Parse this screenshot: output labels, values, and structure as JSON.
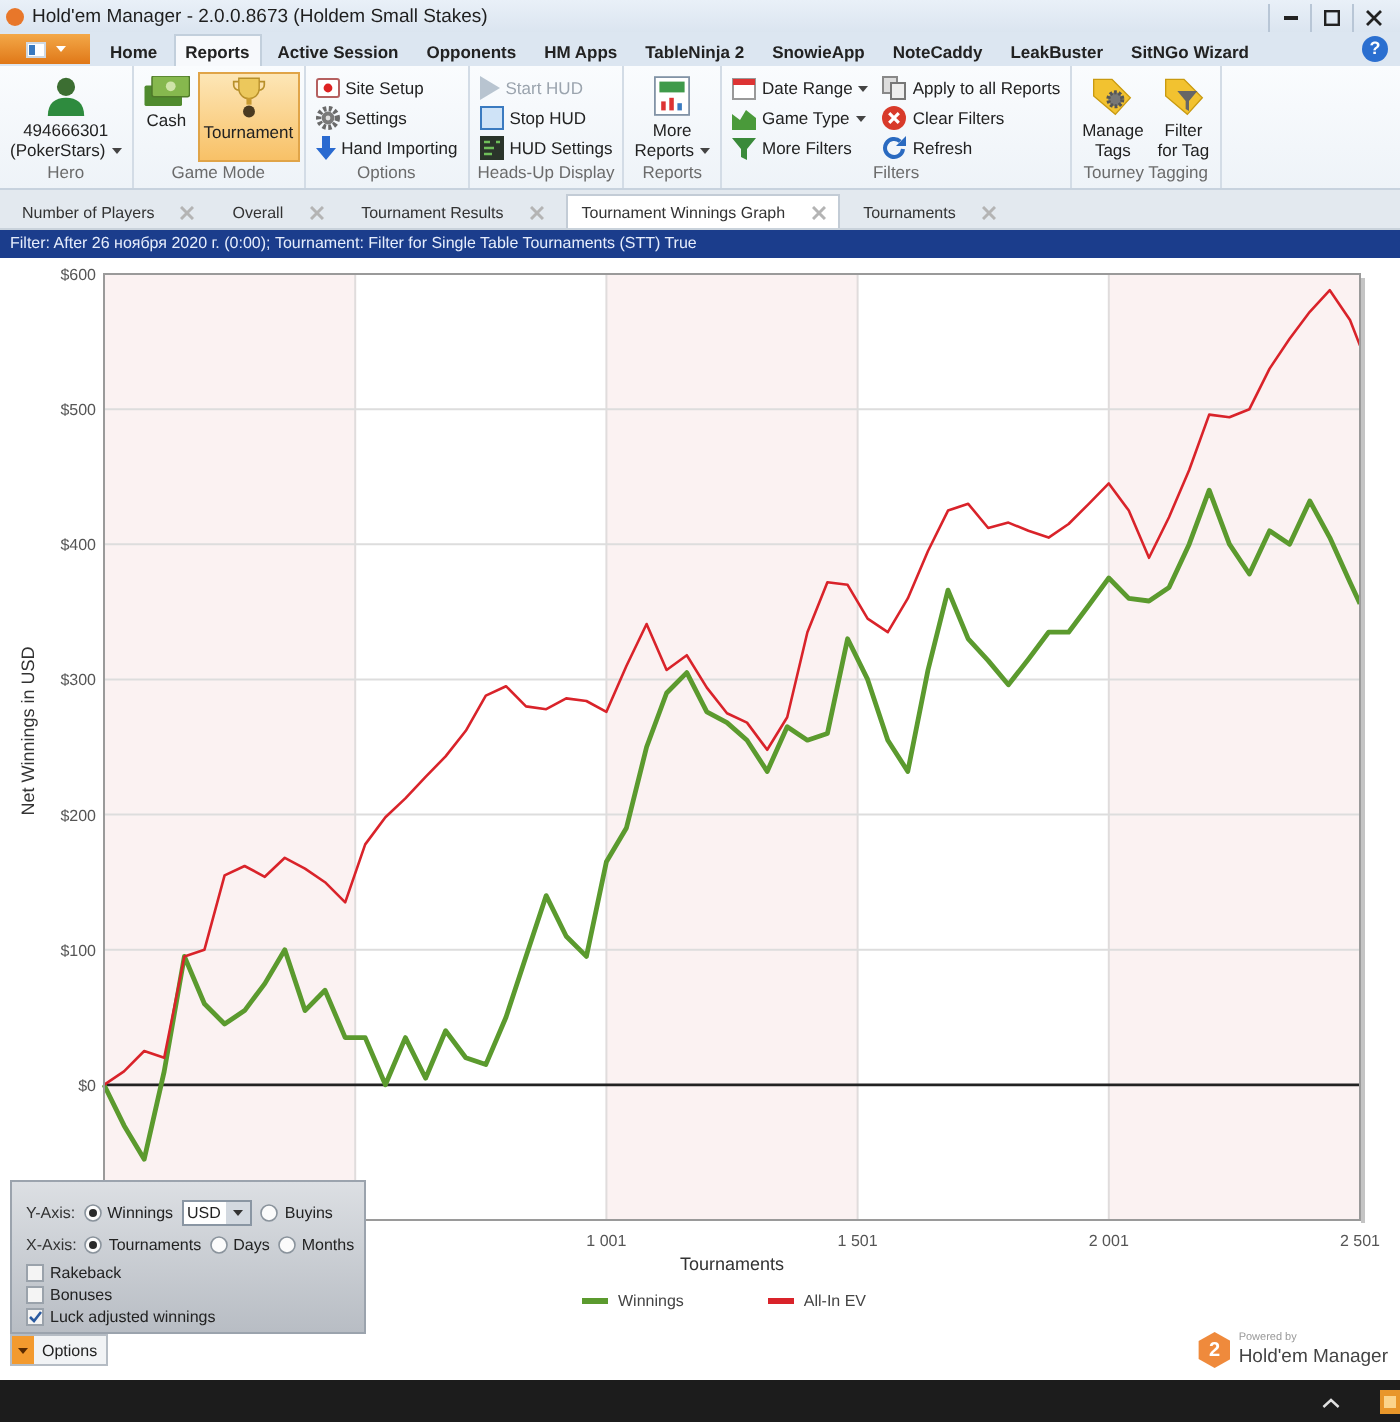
{
  "window": {
    "title": "Hold'em Manager - 2.0.0.8673 (Holdem Small Stakes)"
  },
  "menu_tabs": [
    {
      "label": "Home",
      "selected": false
    },
    {
      "label": "Reports",
      "selected": true
    },
    {
      "label": "Active Session",
      "selected": false
    },
    {
      "label": "Opponents",
      "selected": false
    },
    {
      "label": "HM Apps",
      "selected": false
    },
    {
      "label": "TableNinja 2",
      "selected": false
    },
    {
      "label": "SnowieApp",
      "selected": false
    },
    {
      "label": "NoteCaddy",
      "selected": false
    },
    {
      "label": "LeakBuster",
      "selected": false
    },
    {
      "label": "SitNGo Wizard",
      "selected": false
    }
  ],
  "help_button": {
    "label": "?"
  },
  "ribbon": {
    "groups": [
      {
        "label": "Hero",
        "columns": [
          [
            {
              "kind": "large",
              "label": "494666301\n(PokerStars)",
              "dropdown": true
            }
          ]
        ]
      },
      {
        "label": "Game Mode",
        "columns": [
          [
            {
              "kind": "large",
              "label": "Cash",
              "dropdown": false,
              "selected": false
            }
          ],
          [
            {
              "kind": "large",
              "label": "Tournament",
              "dropdown": false,
              "selected": true
            }
          ]
        ]
      },
      {
        "label": "Options",
        "columns": [
          [
            {
              "kind": "small",
              "label": "Site Setup",
              "dropdown": false
            },
            {
              "kind": "small",
              "label": "Settings",
              "dropdown": false
            },
            {
              "kind": "small",
              "label": "Hand Importing",
              "dropdown": false
            }
          ]
        ]
      },
      {
        "label": "Heads-Up Display",
        "columns": [
          [
            {
              "kind": "small",
              "label": "Start HUD",
              "dropdown": false,
              "disabled": true
            },
            {
              "kind": "small",
              "label": "Stop HUD",
              "dropdown": false,
              "disabled": false
            },
            {
              "kind": "small",
              "label": "HUD Settings",
              "dropdown": false,
              "disabled": false
            }
          ]
        ]
      },
      {
        "label": "Reports",
        "columns": [
          [
            {
              "kind": "large",
              "label": "More\nReports",
              "dropdown": true
            }
          ]
        ]
      },
      {
        "label": "Filters",
        "columns": [
          [
            {
              "kind": "small",
              "label": "Date Range",
              "dropdown": true
            },
            {
              "kind": "small",
              "label": "Game Type",
              "dropdown": true
            },
            {
              "kind": "small",
              "label": "More Filters",
              "dropdown": false
            }
          ],
          [
            {
              "kind": "small",
              "label": "Apply to all Reports",
              "dropdown": false
            },
            {
              "kind": "small",
              "label": "Clear Filters",
              "dropdown": false
            },
            {
              "kind": "small",
              "label": "Refresh",
              "dropdown": false
            }
          ]
        ]
      },
      {
        "label": "Tourney Tagging",
        "columns": [
          [
            {
              "kind": "large",
              "label": "Manage\nTags",
              "dropdown": false
            }
          ],
          [
            {
              "kind": "large",
              "label": "Filter\nfor Tag",
              "dropdown": false
            }
          ]
        ]
      }
    ]
  },
  "report_tabs": [
    {
      "label": "Number of Players",
      "selected": false
    },
    {
      "label": "Overall",
      "selected": false
    },
    {
      "label": "Tournament Results",
      "selected": false
    },
    {
      "label": "Tournament Winnings Graph",
      "selected": true
    },
    {
      "label": "Tournaments",
      "selected": false
    }
  ],
  "filter_bar": {
    "text": "Filter: After 26 ноября 2020 г. (0:00); Tournament: Filter for Single Table Tournaments (STT) True"
  },
  "chart": {
    "chart_data": {
      "type": "line",
      "xlabel": "Tournaments",
      "ylabel": "Net Winnings in USD",
      "x": [
        1,
        41,
        81,
        121,
        161,
        201,
        241,
        281,
        321,
        361,
        401,
        441,
        481,
        521,
        561,
        601,
        641,
        681,
        721,
        761,
        801,
        841,
        881,
        921,
        961,
        1001,
        1041,
        1081,
        1121,
        1161,
        1201,
        1241,
        1281,
        1321,
        1361,
        1401,
        1441,
        1481,
        1521,
        1561,
        1601,
        1641,
        1681,
        1721,
        1761,
        1801,
        1841,
        1881,
        1921,
        1961,
        2001,
        2041,
        2081,
        2121,
        2161,
        2201,
        2241,
        2281,
        2321,
        2361,
        2401,
        2441,
        2481,
        2501
      ],
      "series": [
        {
          "name": "Winnings",
          "color": "#5b9a2e",
          "values": [
            0,
            -30,
            -55,
            10,
            95,
            60,
            45,
            55,
            75,
            100,
            55,
            70,
            35,
            35,
            0,
            35,
            5,
            40,
            20,
            15,
            50,
            95,
            140,
            110,
            95,
            165,
            190,
            250,
            290,
            305,
            276,
            268,
            255,
            232,
            265,
            255,
            260,
            330,
            300,
            255,
            232,
            307,
            366,
            330,
            314,
            296,
            315,
            335,
            335,
            355,
            375,
            360,
            358,
            368,
            400,
            440,
            400,
            378,
            410,
            400,
            432,
            405,
            372,
            356
          ]
        },
        {
          "name": "All-In EV",
          "color": "#d9232a",
          "values": [
            0,
            10,
            25,
            20,
            95,
            100,
            155,
            162,
            154,
            168,
            160,
            150,
            135,
            178,
            198,
            212,
            228,
            243,
            262,
            288,
            295,
            280,
            278,
            286,
            284,
            276,
            310,
            341,
            307,
            318,
            294,
            275,
            268,
            248,
            272,
            335,
            372,
            370,
            345,
            335,
            360,
            395,
            425,
            430,
            412,
            416,
            410,
            405,
            415,
            430,
            445,
            425,
            390,
            420,
            455,
            496,
            494,
            500,
            530,
            552,
            572,
            588,
            566,
            547
          ]
        }
      ],
      "xlim": [
        1,
        2501
      ],
      "ylim": [
        -100,
        600
      ],
      "xticks": [
        {
          "value": 1001,
          "label": "1 001"
        },
        {
          "value": 1501,
          "label": "1 501"
        },
        {
          "value": 2001,
          "label": "2 001"
        },
        {
          "value": 2501,
          "label": "2 501"
        }
      ],
      "yticks": [
        {
          "value": 0,
          "label": "$0"
        },
        {
          "value": 100,
          "label": "$100"
        },
        {
          "value": 200,
          "label": "$200"
        },
        {
          "value": 300,
          "label": "$300"
        },
        {
          "value": 400,
          "label": "$400"
        },
        {
          "value": 500,
          "label": "$500"
        },
        {
          "value": 600,
          "label": "$600"
        }
      ],
      "grid": true,
      "legend": true
    }
  },
  "options_panel": {
    "y_axis": {
      "label": "Y-Axis:",
      "options": [
        {
          "label": "Winnings",
          "selected": true
        },
        {
          "label": "Buyins",
          "selected": false
        }
      ],
      "currency": "USD"
    },
    "x_axis": {
      "label": "X-Axis:",
      "options": [
        {
          "label": "Tournaments",
          "selected": true
        },
        {
          "label": "Days",
          "selected": false
        },
        {
          "label": "Months",
          "selected": false
        }
      ]
    },
    "checkboxes": [
      {
        "label": "Rakeback",
        "checked": false
      },
      {
        "label": "Bonuses",
        "checked": false
      },
      {
        "label": "Luck adjusted winnings",
        "checked": true
      }
    ],
    "toggle_button": {
      "label": "Options",
      "expanded": true
    }
  },
  "logo": {
    "mark": "2",
    "caption": "Powered by",
    "name": "Hold'em Manager"
  }
}
